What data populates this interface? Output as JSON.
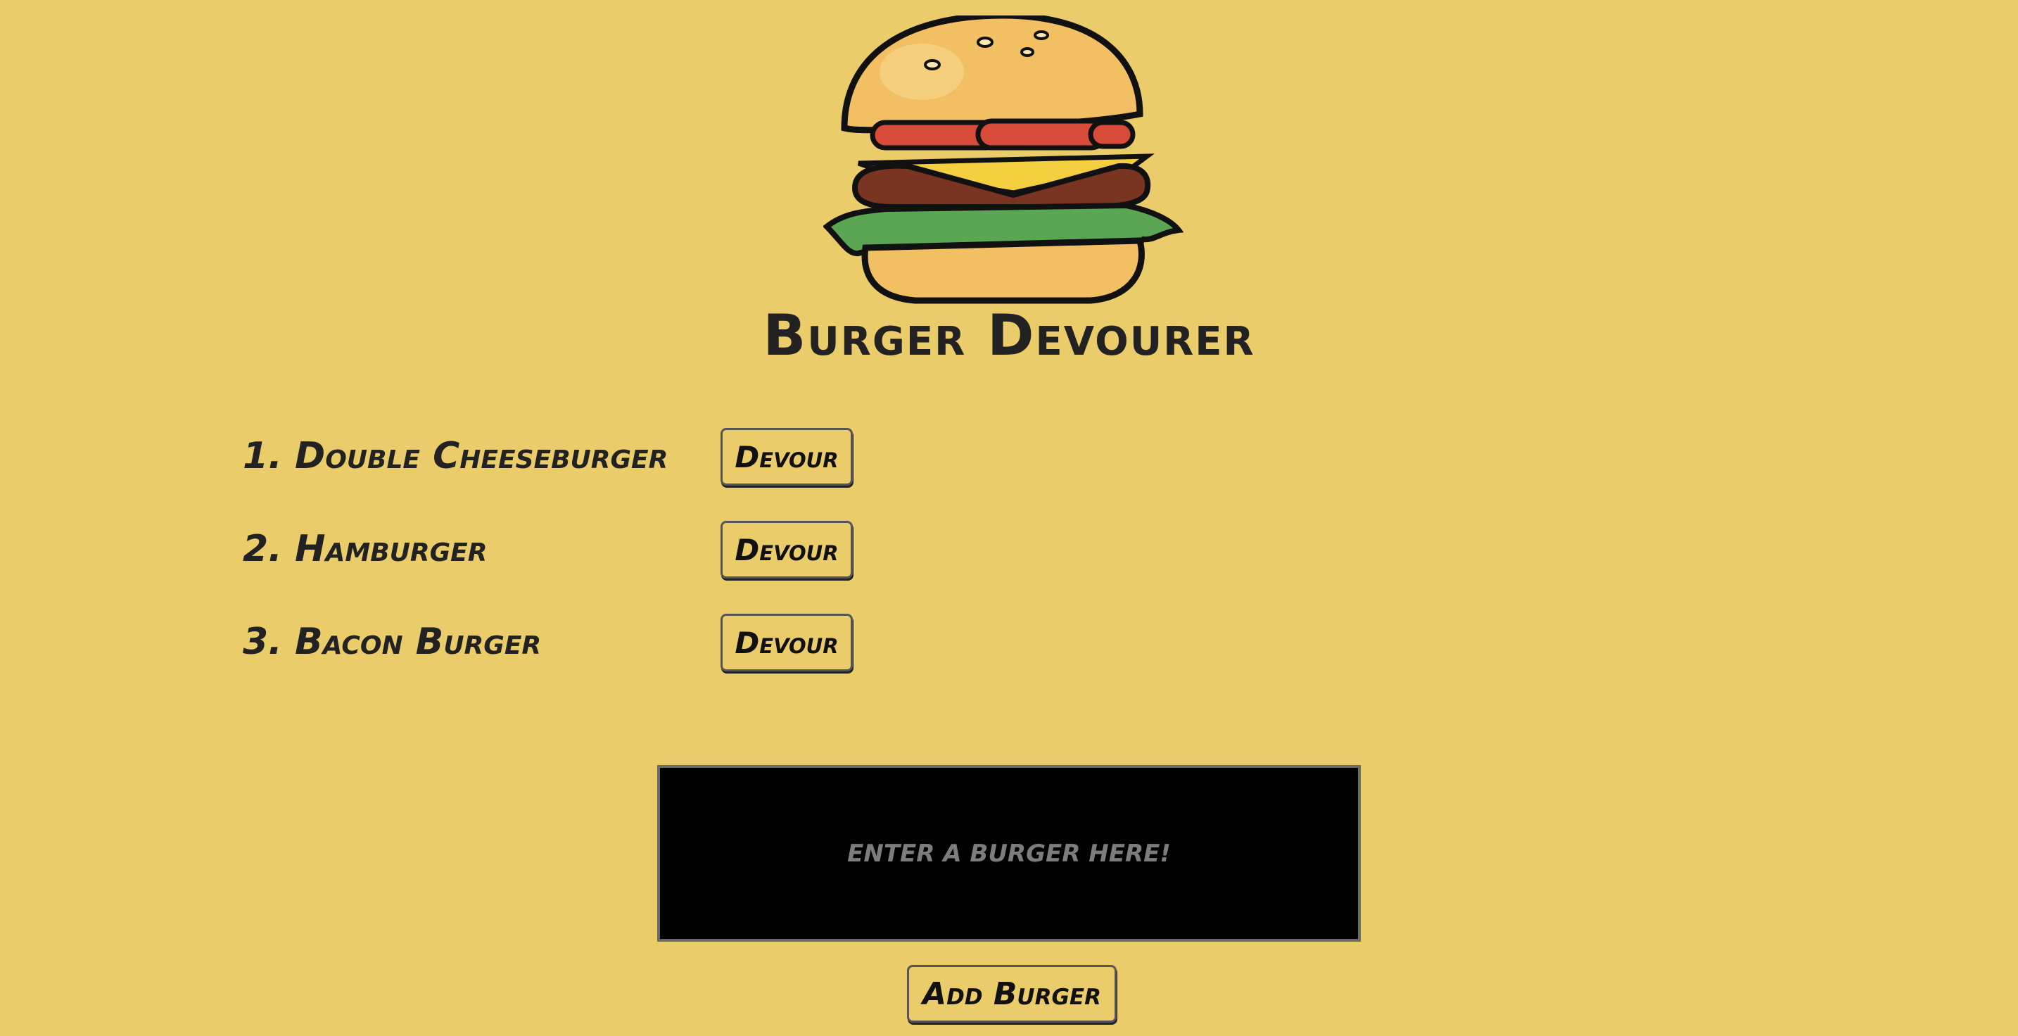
{
  "header": {
    "logo": "burger-logo",
    "title": "Burger Devourer"
  },
  "burgers": [
    {
      "label": "1. Double Cheeseburger",
      "devour_label": "Devour"
    },
    {
      "label": "2. Hamburger",
      "devour_label": "Devour"
    },
    {
      "label": "3. Bacon Burger",
      "devour_label": "Devour"
    }
  ],
  "form": {
    "input_value": "",
    "input_placeholder": "enter a burger here!",
    "submit_label": "Add Burger"
  },
  "colors": {
    "background": "#ebcc6b",
    "text": "#222222",
    "input_background": "#000000",
    "placeholder": "#7d7d7d"
  }
}
